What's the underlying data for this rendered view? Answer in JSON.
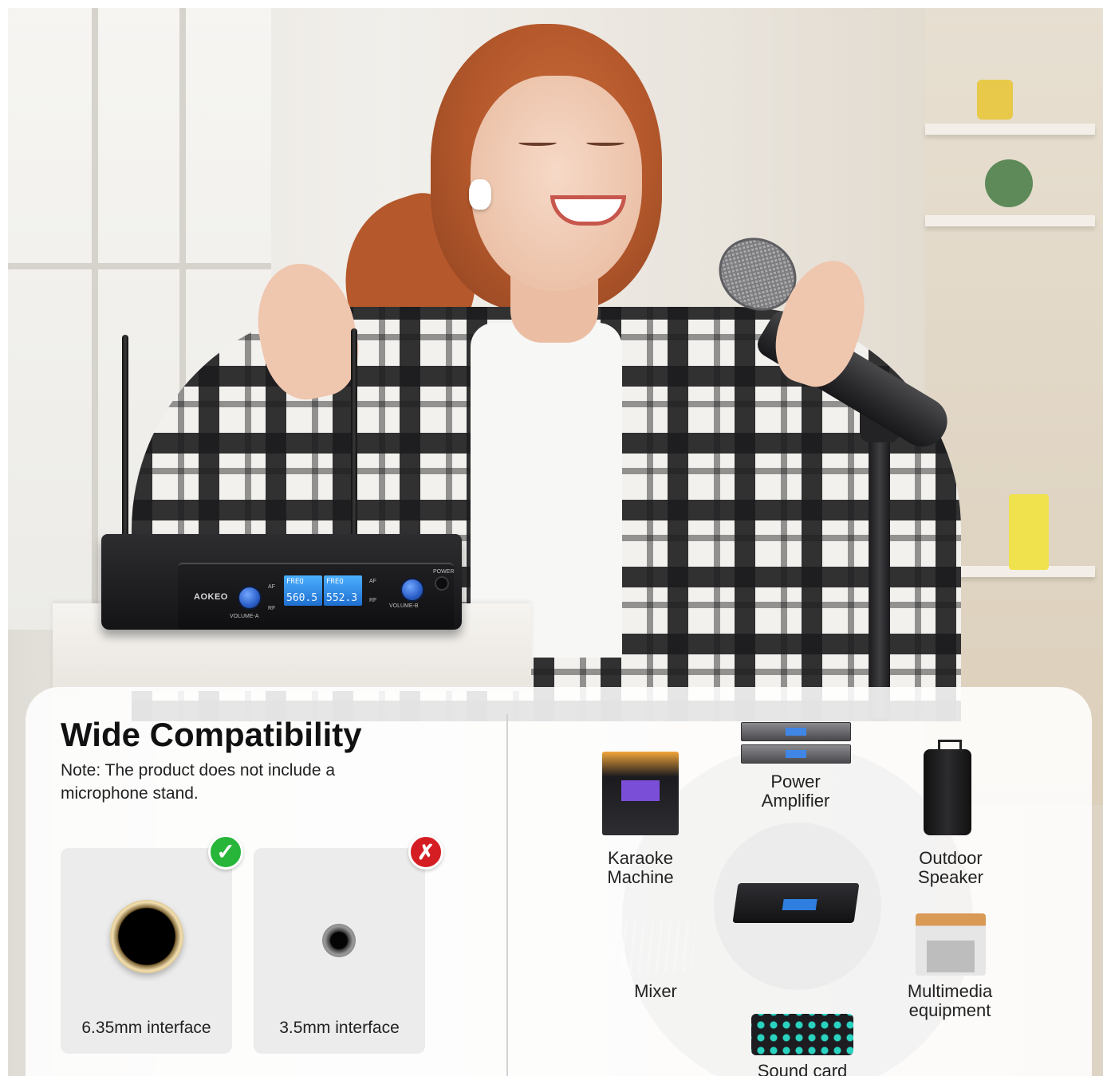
{
  "scene": {
    "receiver": {
      "brand": "AOKEO",
      "channel_a": {
        "label": "FREQ",
        "value": "560.5",
        "knob_label": "VOLUME-A"
      },
      "channel_b": {
        "label": "FREQ",
        "value": "552.3",
        "knob_label": "VOLUME-B"
      },
      "af_label": "AF",
      "rf_label": "RF",
      "power_label": "POWER"
    }
  },
  "panel": {
    "title": "Wide Compatibility",
    "note": "Note: The product does not include a microphone stand.",
    "ports": [
      {
        "label": "6.35mm interface",
        "status": "supported",
        "badge": "✓"
      },
      {
        "label": "3.5mm interface",
        "status": "unsupported",
        "badge": "✗"
      }
    ],
    "devices": {
      "power_amplifier": "Power Amplifier",
      "karaoke_machine": "Karaoke Machine",
      "outdoor_speaker": "Outdoor Speaker",
      "mixer": "Mixer",
      "multimedia_equipment": "Multimedia equipment",
      "sound_card": "Sound card"
    }
  },
  "colors": {
    "ok_badge": "#27b53a",
    "no_badge": "#d51e23",
    "lcd_blue": "#2e7fe0"
  },
  "icons": [
    "check-icon",
    "cross-icon"
  ]
}
